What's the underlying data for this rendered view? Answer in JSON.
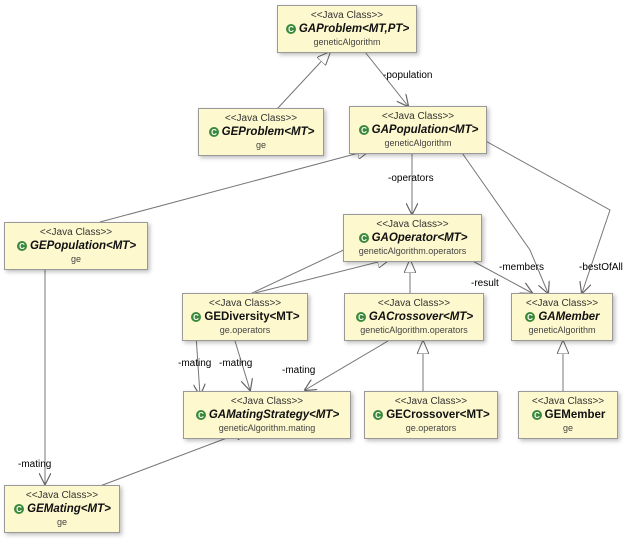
{
  "nodes": {
    "gaProblem": {
      "stereo": "<<Java Class>>",
      "name": "GAProblem<MT,PT>",
      "pkg": "geneticAlgorithm",
      "abstract": true
    },
    "geProblem": {
      "stereo": "<<Java Class>>",
      "name": "GEProblem<MT>",
      "pkg": "ge",
      "abstract": true
    },
    "gaPopulation": {
      "stereo": "<<Java Class>>",
      "name": "GAPopulation<MT>",
      "pkg": "geneticAlgorithm",
      "abstract": true
    },
    "gePopulation": {
      "stereo": "<<Java Class>>",
      "name": "GEPopulation<MT>",
      "pkg": "ge",
      "abstract": true
    },
    "gaOperator": {
      "stereo": "<<Java Class>>",
      "name": "GAOperator<MT>",
      "pkg": "geneticAlgorithm.operators",
      "abstract": true
    },
    "geDiversity": {
      "stereo": "<<Java Class>>",
      "name": "GEDiversity<MT>",
      "pkg": "ge.operators",
      "abstract": false
    },
    "gaCrossover": {
      "stereo": "<<Java Class>>",
      "name": "GACrossover<MT>",
      "pkg": "geneticAlgorithm.operators",
      "abstract": true
    },
    "gaMember": {
      "stereo": "<<Java Class>>",
      "name": "GAMember",
      "pkg": "geneticAlgorithm",
      "abstract": true
    },
    "gaMatingStrat": {
      "stereo": "<<Java Class>>",
      "name": "GAMatingStrategy<MT>",
      "pkg": "geneticAlgorithm.mating",
      "abstract": true
    },
    "geCrossover": {
      "stereo": "<<Java Class>>",
      "name": "GECrossover<MT>",
      "pkg": "ge.operators",
      "abstract": false
    },
    "geMember": {
      "stereo": "<<Java Class>>",
      "name": "GEMember",
      "pkg": "ge",
      "abstract": false
    },
    "geMating": {
      "stereo": "<<Java Class>>",
      "name": "GEMating<MT>",
      "pkg": "ge",
      "abstract": true
    }
  },
  "labels": {
    "population": "-population",
    "operators": "-operators",
    "members": "-members",
    "bestOfAll": "-bestOfAll",
    "result": "-result",
    "mating": "-mating"
  },
  "chart_data": {
    "type": "uml-class-diagram",
    "classes": [
      {
        "name": "GAProblem<MT,PT>",
        "package": "geneticAlgorithm",
        "abstract": true
      },
      {
        "name": "GEProblem<MT>",
        "package": "ge",
        "abstract": true
      },
      {
        "name": "GAPopulation<MT>",
        "package": "geneticAlgorithm",
        "abstract": true
      },
      {
        "name": "GEPopulation<MT>",
        "package": "ge",
        "abstract": true
      },
      {
        "name": "GAOperator<MT>",
        "package": "geneticAlgorithm.operators",
        "abstract": true
      },
      {
        "name": "GEDiversity<MT>",
        "package": "ge.operators",
        "abstract": false
      },
      {
        "name": "GACrossover<MT>",
        "package": "geneticAlgorithm.operators",
        "abstract": true
      },
      {
        "name": "GAMember",
        "package": "geneticAlgorithm",
        "abstract": true
      },
      {
        "name": "GAMatingStrategy<MT>",
        "package": "geneticAlgorithm.mating",
        "abstract": true
      },
      {
        "name": "GECrossover<MT>",
        "package": "ge.operators",
        "abstract": false
      },
      {
        "name": "GEMember",
        "package": "ge",
        "abstract": false
      },
      {
        "name": "GEMating<MT>",
        "package": "ge",
        "abstract": true
      }
    ],
    "relationships": [
      {
        "type": "generalization",
        "from": "GEProblem<MT>",
        "to": "GAProblem<MT,PT>"
      },
      {
        "type": "generalization",
        "from": "GEPopulation<MT>",
        "to": "GAPopulation<MT>"
      },
      {
        "type": "generalization",
        "from": "GEDiversity<MT>",
        "to": "GAOperator<MT>"
      },
      {
        "type": "generalization",
        "from": "GACrossover<MT>",
        "to": "GAOperator<MT>"
      },
      {
        "type": "generalization",
        "from": "GECrossover<MT>",
        "to": "GACrossover<MT>"
      },
      {
        "type": "generalization",
        "from": "GEMember",
        "to": "GAMember"
      },
      {
        "type": "generalization",
        "from": "GEMating<MT>",
        "to": "GAMatingStrategy<MT>"
      },
      {
        "type": "association",
        "from": "GAProblem<MT,PT>",
        "to": "GAPopulation<MT>",
        "role": "-population"
      },
      {
        "type": "association",
        "from": "GAPopulation<MT>",
        "to": "GAOperator<MT>",
        "role": "-operators"
      },
      {
        "type": "association",
        "from": "GAPopulation<MT>",
        "to": "GAMember",
        "role": "-members"
      },
      {
        "type": "association",
        "from": "GAPopulation<MT>",
        "to": "GAMember",
        "role": "-bestOfAll"
      },
      {
        "type": "association",
        "from": "GAOperator<MT>",
        "to": "GAMember",
        "role": "-result"
      },
      {
        "type": "association",
        "from": "GEDiversity<MT>",
        "to": "GAMatingStrategy<MT>",
        "role": "-mating"
      },
      {
        "type": "association",
        "from": "GACrossover<MT>",
        "to": "GAMatingStrategy<MT>",
        "role": "-mating"
      },
      {
        "type": "association",
        "from": "GAOperator<MT>",
        "to": "GAMatingStrategy<MT>",
        "role": "-mating"
      },
      {
        "type": "association",
        "from": "GEPopulation<MT>",
        "to": "GEMating<MT>",
        "role": "-mating"
      }
    ]
  }
}
